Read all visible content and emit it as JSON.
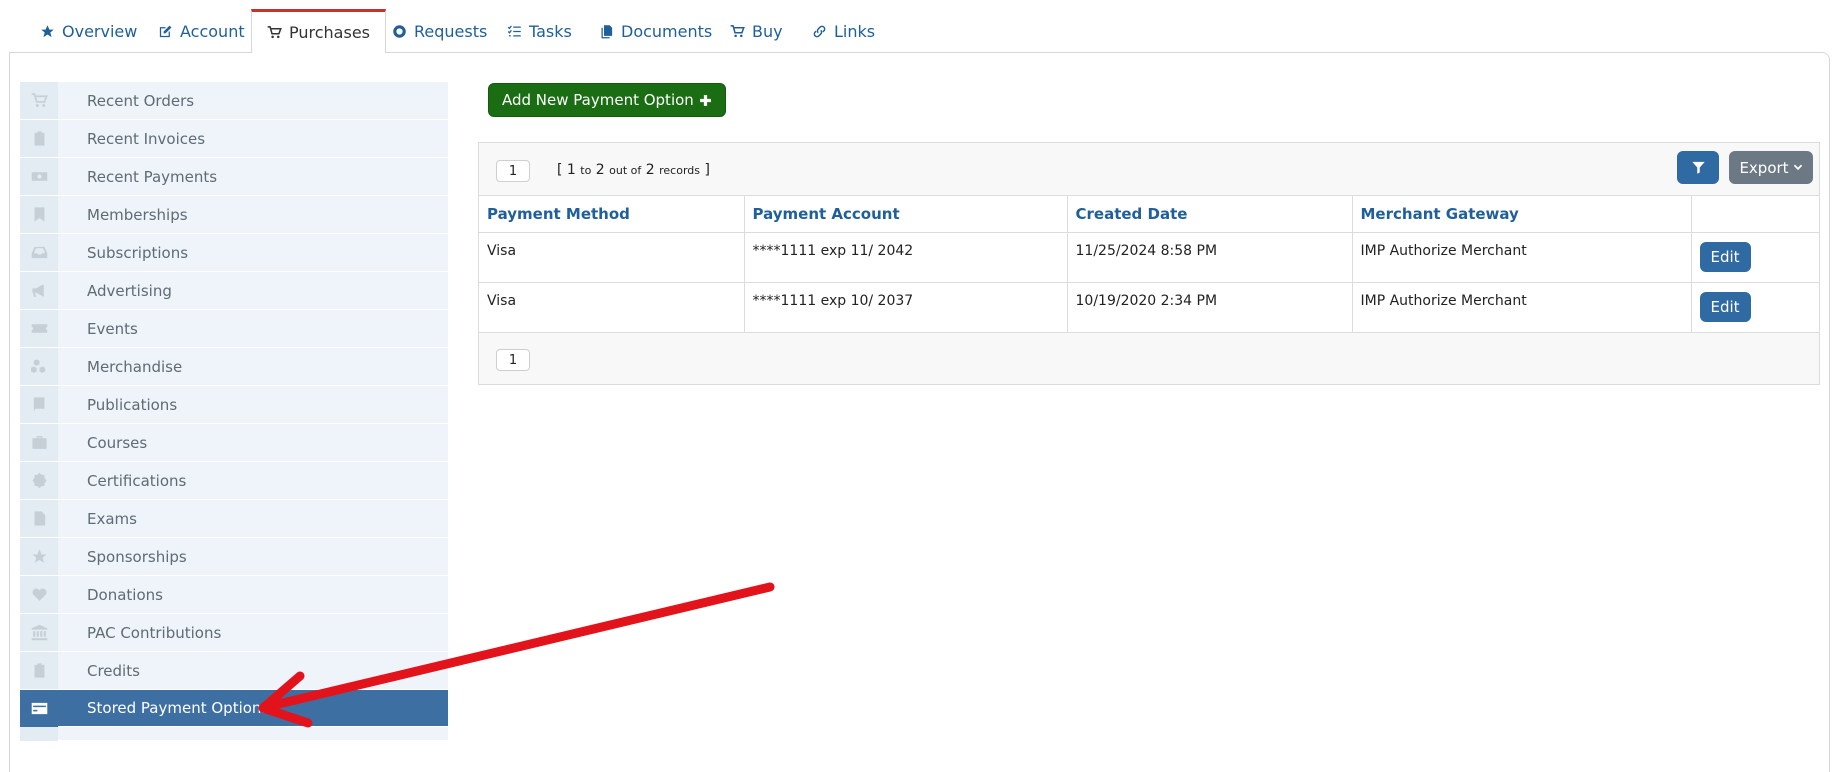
{
  "tabs": [
    {
      "label": "Overview",
      "icon": "star-icon",
      "active": false
    },
    {
      "label": "Account",
      "icon": "edit-icon",
      "active": false
    },
    {
      "label": "Purchases",
      "icon": "cart-icon",
      "active": true
    },
    {
      "label": "Requests",
      "icon": "lifebuoy-icon",
      "active": false
    },
    {
      "label": "Tasks",
      "icon": "tasks-icon",
      "active": false
    },
    {
      "label": "Documents",
      "icon": "documents-icon",
      "active": false
    },
    {
      "label": "Buy",
      "icon": "cart-icon",
      "active": false
    },
    {
      "label": "Links",
      "icon": "link-icon",
      "active": false
    }
  ],
  "sidebar": {
    "items": [
      {
        "label": "Recent Orders",
        "icon": "cart-icon"
      },
      {
        "label": "Recent Invoices",
        "icon": "clipboard-icon"
      },
      {
        "label": "Recent Payments",
        "icon": "money-icon"
      },
      {
        "label": "Memberships",
        "icon": "bookmark-icon"
      },
      {
        "label": "Subscriptions",
        "icon": "inbox-icon"
      },
      {
        "label": "Advertising",
        "icon": "megaphone-icon"
      },
      {
        "label": "Events",
        "icon": "ticket-icon"
      },
      {
        "label": "Merchandise",
        "icon": "cubes-icon"
      },
      {
        "label": "Publications",
        "icon": "book-icon"
      },
      {
        "label": "Courses",
        "icon": "briefcase-icon"
      },
      {
        "label": "Certifications",
        "icon": "certificate-icon"
      },
      {
        "label": "Exams",
        "icon": "file-icon"
      },
      {
        "label": "Sponsorships",
        "icon": "star-icon"
      },
      {
        "label": "Donations",
        "icon": "heart-icon"
      },
      {
        "label": "PAC Contributions",
        "icon": "bank-icon"
      },
      {
        "label": "Credits",
        "icon": "clipboard-icon"
      },
      {
        "label": "Stored Payment Options",
        "icon": "credit-card-icon",
        "active": true
      }
    ]
  },
  "toolbar": {
    "add_label": "Add New Payment Option",
    "export_label": "Export"
  },
  "pager": {
    "page": "1",
    "open": "[",
    "from": "1",
    "to_word": "to",
    "to": "2",
    "outof_word": "out of",
    "total": "2",
    "records_word": "records",
    "close": "]"
  },
  "table": {
    "headers": [
      "Payment Method",
      "Payment Account",
      "Created Date",
      "Merchant Gateway",
      ""
    ],
    "rows": [
      {
        "method": "Visa",
        "account": "****1111 exp 11/ 2042",
        "created": "11/25/2024 8:58 PM",
        "gateway": "IMP Authorize Merchant",
        "action": "Edit"
      },
      {
        "method": "Visa",
        "account": "****1111 exp 10/ 2037",
        "created": "10/19/2020 2:34 PM",
        "gateway": "IMP Authorize Merchant",
        "action": "Edit"
      }
    ]
  },
  "colors": {
    "link_blue": "#1f5f9a",
    "active_tab_border": "#c6322b",
    "sidebar_active": "#3d6fa3",
    "add_button_green": "#1a6d12",
    "primary_button": "#2f6aa3",
    "export_gray": "#6c7985",
    "annotation_arrow": "#e3131b"
  }
}
